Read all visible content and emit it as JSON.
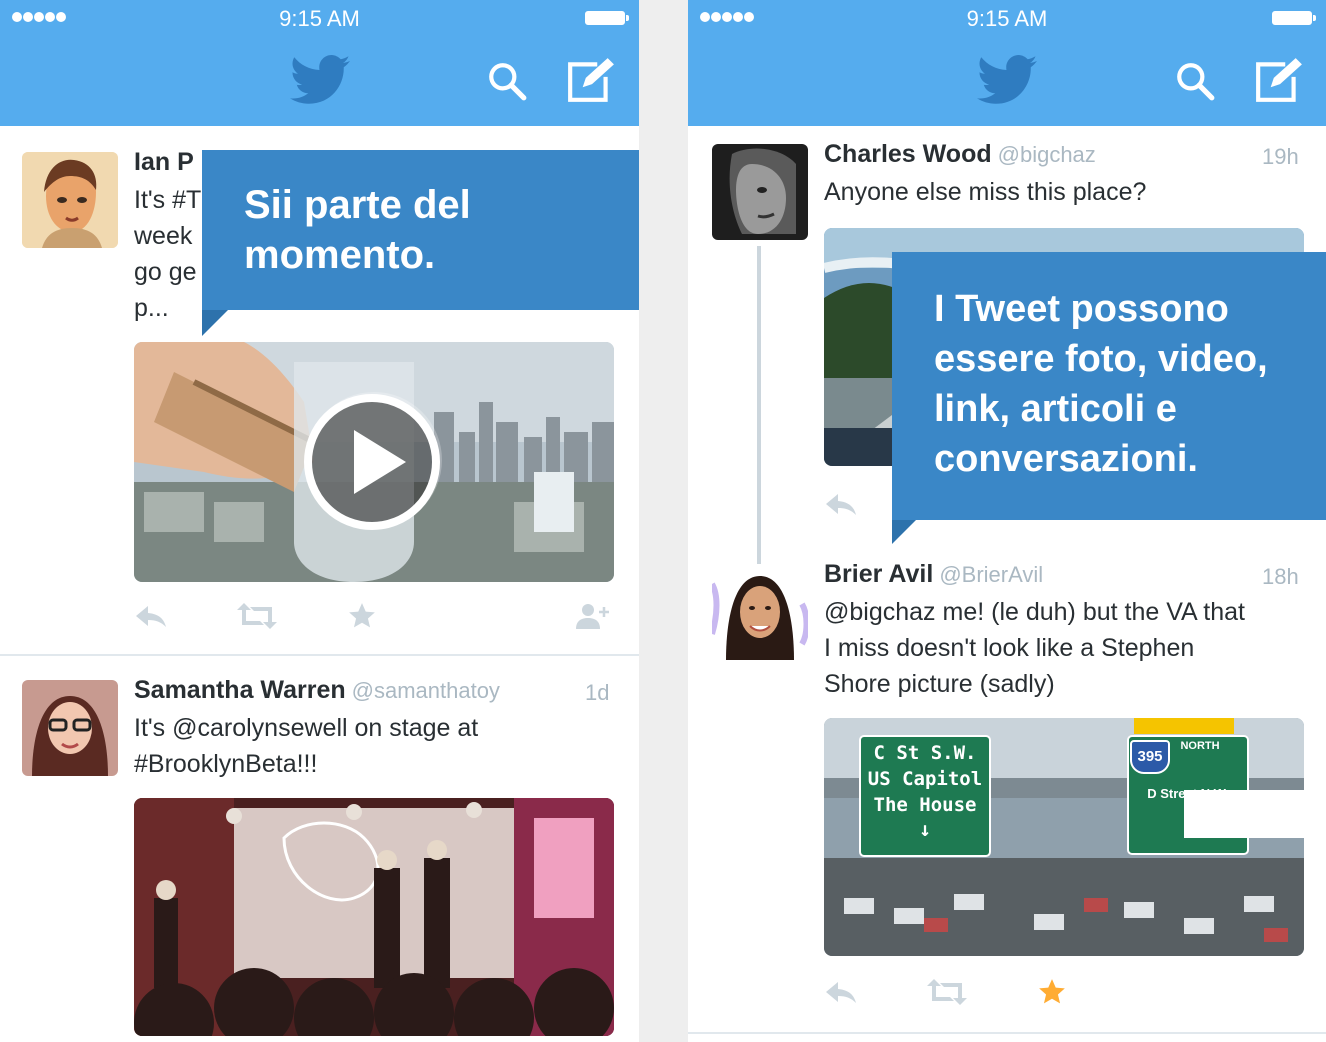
{
  "screens": [
    {
      "status": {
        "time": "9:15 AM"
      },
      "coach_mark": {
        "line1": "Sii parte del",
        "line2": "momento."
      },
      "tweets": [
        {
          "name": "Ian P",
          "lines": [
            "It's #T",
            "week",
            "go ge",
            "p..."
          ]
        },
        {
          "name": "Samantha Warren",
          "handle": "@samanthatoy",
          "time": "1d",
          "lines": [
            "It's @carolynsewell on stage at",
            "#BrooklynBeta!!!"
          ]
        }
      ]
    },
    {
      "status": {
        "time": "9:15 AM"
      },
      "coach_mark": {
        "line1": "I Tweet possono",
        "line2": "essere foto, video,",
        "line3": "link, articoli e",
        "line4": "conversazioni."
      },
      "tweets": [
        {
          "name": "Charles Wood",
          "handle": "@bigchaz",
          "time": "19h",
          "lines": [
            "Anyone else miss this place?"
          ]
        },
        {
          "name": "Brier Avil",
          "handle": "@BrierAvil",
          "time": "18h",
          "lines": [
            "@bigchaz me! (le duh) but the VA that",
            "I miss doesn't look like a Stephen",
            "Shore picture (sadly)"
          ],
          "sign_left": {
            "l1": "C St S.W.",
            "l2": "US Capitol",
            "l3": "The House"
          },
          "sign_right": {
            "shield": "395",
            "north": "NORTH",
            "l1": "D Street N.W."
          }
        }
      ]
    }
  ],
  "colors": {
    "brand": "#55acee",
    "coach": "#3a87c7",
    "favorite": "#ffac33",
    "action": "#ccd6dd"
  },
  "icons": [
    "twitter-bird-icon",
    "search-icon",
    "compose-icon",
    "reply-icon",
    "retweet-icon",
    "favorite-icon",
    "follow-icon",
    "play-icon"
  ]
}
